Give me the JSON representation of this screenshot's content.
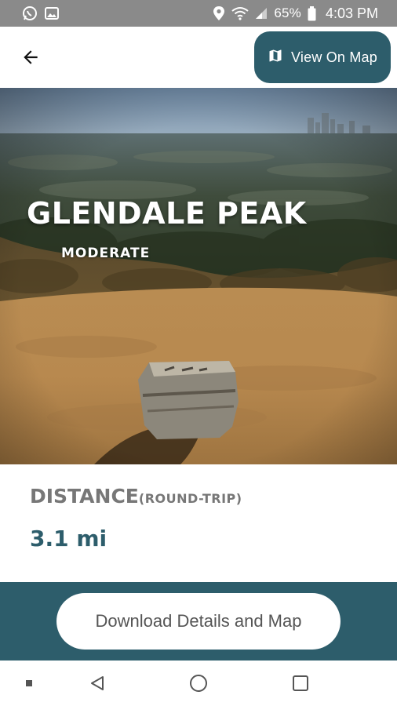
{
  "status_bar": {
    "left_icons": [
      "whatsapp-icon",
      "image-icon"
    ],
    "right_icons": [
      "location-icon",
      "wifi-icon",
      "signal-icon",
      "battery-icon"
    ],
    "battery": "65%",
    "time": "4:03 PM"
  },
  "app_bar": {
    "back_icon": "arrow-back-icon",
    "map_icon": "map-icon",
    "view_map_label": "View On Map"
  },
  "hero": {
    "trail_name": "GLENDALE PEAK",
    "difficulty": "MODERATE"
  },
  "details": {
    "distance_label": "DISTANCE",
    "distance_qualifier": "(ROUND-TRIP)",
    "distance_value": "3.1 mi"
  },
  "actions": {
    "download_label": "Download Details and Map"
  },
  "nav_bar": {
    "icons": [
      "dot-icon",
      "back-triangle-icon",
      "home-circle-icon",
      "recents-square-icon"
    ]
  },
  "colors": {
    "primary": "#2d5d6b",
    "status_bar": "#8a8a8a",
    "heading_gray": "#777777"
  }
}
